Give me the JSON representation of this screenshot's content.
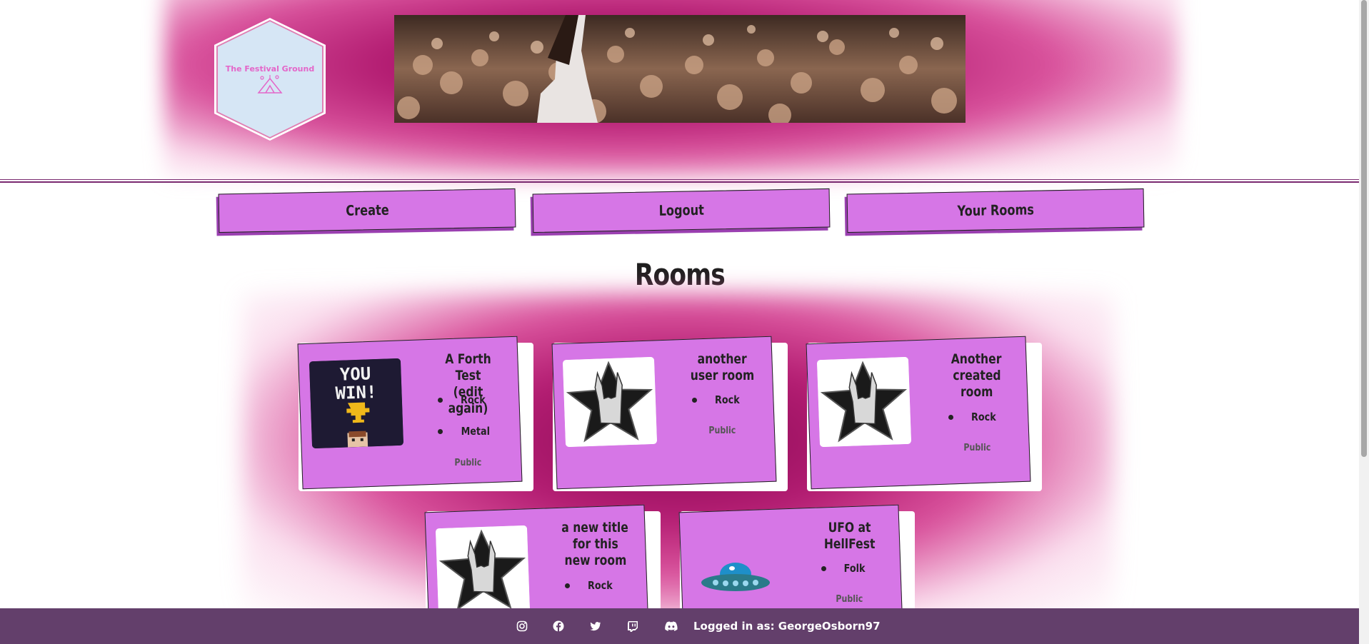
{
  "header": {
    "logo_text": "The Festival Ground",
    "banner_alt": "crowd-photo"
  },
  "nav": {
    "create": "Create",
    "logout": "Logout",
    "your_rooms": "Your Rooms"
  },
  "page_title": "Rooms",
  "rooms": [
    {
      "title_lines": [
        "A Forth Test",
        "(edit again)"
      ],
      "genres": [
        "Rock",
        "Metal"
      ],
      "visibility": "Public",
      "image": "you-win-pixel-art"
    },
    {
      "title_lines": [
        "another",
        "user room"
      ],
      "genres": [
        "Rock"
      ],
      "visibility": "Public",
      "image": "rock-hand-star"
    },
    {
      "title_lines": [
        "Another",
        "created",
        "room"
      ],
      "genres": [
        "Rock"
      ],
      "visibility": "Public",
      "image": "rock-hand-star"
    },
    {
      "title_lines": [
        "a new title",
        "for this",
        "new room"
      ],
      "genres": [
        "Rock"
      ],
      "visibility": "",
      "image": "rock-hand-star"
    },
    {
      "title_lines": [
        "UFO at",
        "HellFest"
      ],
      "genres": [
        "Folk"
      ],
      "visibility": "Public",
      "image": "ufo-pixel-art"
    }
  ],
  "you_win_text": [
    "YOU",
    "WIN!"
  ],
  "footer": {
    "icons": [
      "instagram-icon",
      "facebook-icon",
      "twitter-icon",
      "twitch-icon",
      "discord-icon"
    ],
    "logged_in": "Logged in as: GeorgeOsborn97"
  },
  "colors": {
    "card": "#d676e6",
    "footer": "#633f6b",
    "glow": "#b31d72"
  }
}
